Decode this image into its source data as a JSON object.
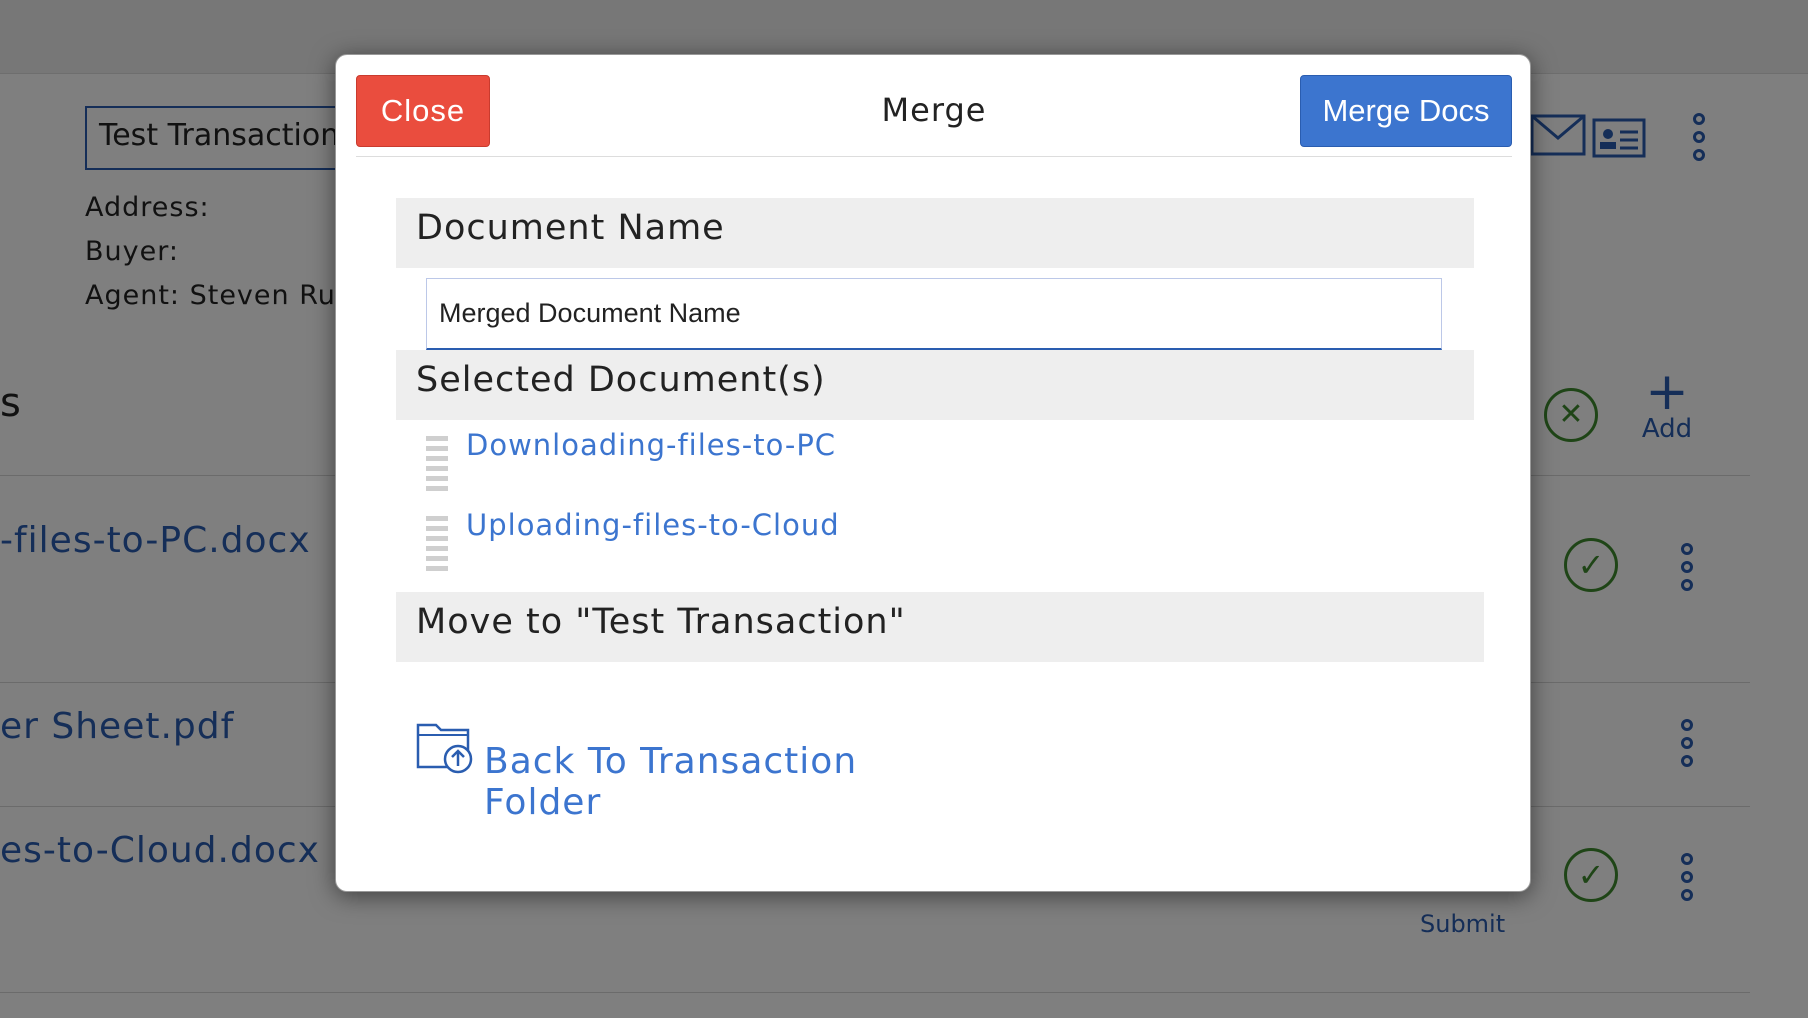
{
  "background": {
    "transaction_name": "Test Transaction",
    "address_label": "Address:",
    "buyer_label": "Buyer:",
    "agent_label": "Agent: Steven Rus",
    "section_heading": "s",
    "files": [
      "-files-to-PC.docx",
      "er Sheet.pdf",
      "es-to-Cloud.docx"
    ],
    "add_label": "Add",
    "submit_label": "Submit"
  },
  "modal": {
    "title": "Merge",
    "close_label": "Close",
    "merge_label": "Merge Docs",
    "document_name_heading": "Document Name",
    "document_name_value": "Merged Document Name",
    "selected_heading": "Selected Document(s)",
    "selected_documents": [
      "Downloading-files-to-PC",
      "Uploading-files-to-Cloud"
    ],
    "move_heading": "Move to \"Test Transaction\"",
    "back_label": "Back To Transaction Folder"
  },
  "colors": {
    "close": "#ea4d3e",
    "primary": "#3c75cf",
    "success": "#3f8a2e"
  }
}
